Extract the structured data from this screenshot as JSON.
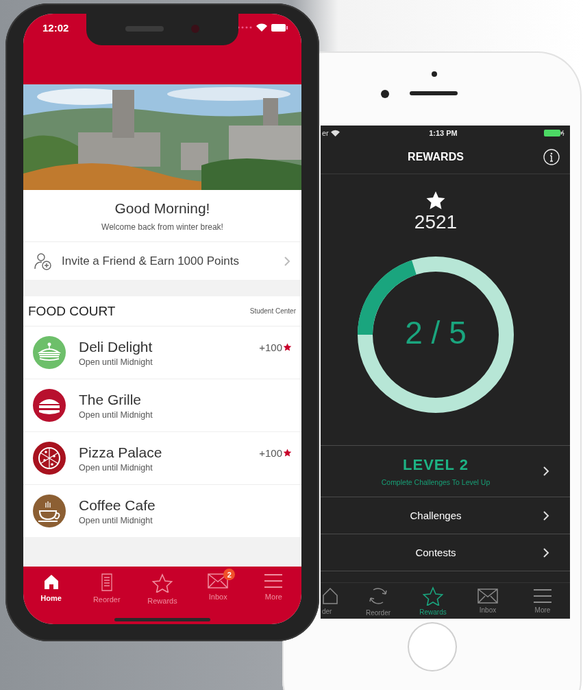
{
  "left_phone": {
    "status_bar": {
      "time": "12:02"
    },
    "greeting": {
      "title": "Good Morning!",
      "subtitle": "Welcome back from winter break!"
    },
    "invite": {
      "label": "Invite a Friend & Earn 1000 Points"
    },
    "section": {
      "title": "FOOD COURT",
      "location": "Student Center"
    },
    "restaurants": [
      {
        "name": "Deli Delight",
        "hours": "Open until Midnight",
        "points": "+100",
        "color": "#6dbf6a"
      },
      {
        "name": "The Grille",
        "hours": "Open until Midnight",
        "color": "#b8102e"
      },
      {
        "name": "Pizza Palace",
        "hours": "Open until Midnight",
        "points": "+100",
        "color": "#a8121f"
      },
      {
        "name": "Coffee Cafe",
        "hours": "Open until Midnight",
        "color": "#8c5f33"
      }
    ],
    "tabs": [
      {
        "label": "Home",
        "selected": true
      },
      {
        "label": "Reorder",
        "selected": false
      },
      {
        "label": "Rewards",
        "selected": false
      },
      {
        "label": "Inbox",
        "selected": false,
        "badge": "2"
      },
      {
        "label": "More",
        "selected": false
      }
    ]
  },
  "right_phone": {
    "status_bar": {
      "carrier": "er",
      "time": "1:13 PM"
    },
    "title": "REWARDS",
    "points": "2521",
    "progress": {
      "text": "2 / 5",
      "level": 0.2
    },
    "level": {
      "title": "LEVEL 2",
      "subtitle": "Complete Challenges To Level Up"
    },
    "menu": [
      {
        "label": "Challenges"
      },
      {
        "label": "Contests"
      }
    ],
    "tabs": [
      {
        "label": "der",
        "selected": false
      },
      {
        "label": "Reorder",
        "selected": false
      },
      {
        "label": "Rewards",
        "selected": true
      },
      {
        "label": "Inbox",
        "selected": false
      },
      {
        "label": "More",
        "selected": false
      }
    ]
  }
}
